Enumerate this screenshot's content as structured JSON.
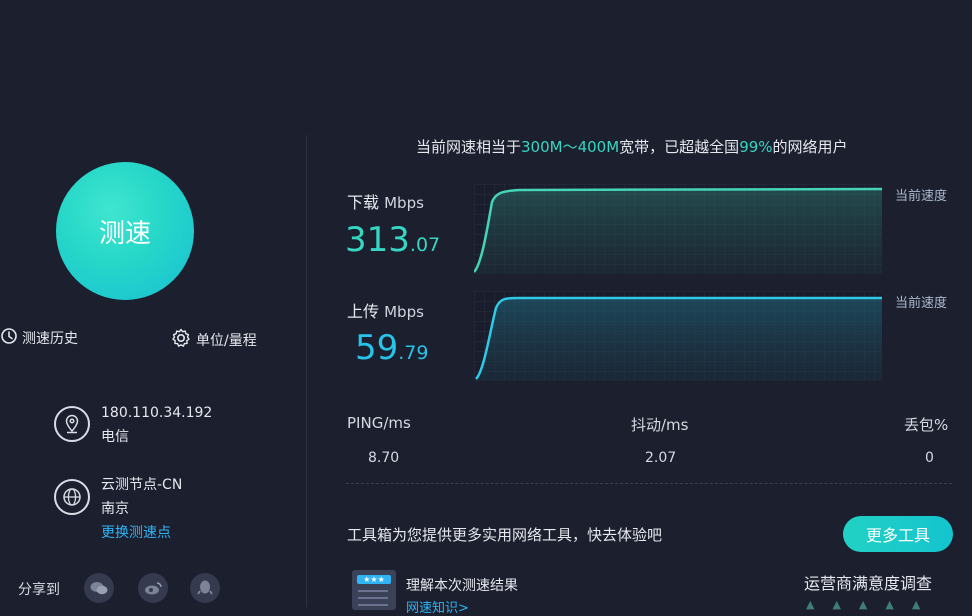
{
  "left": {
    "speed_button": "测速",
    "history_link": "测速历史",
    "unit_link": "单位/量程",
    "ip": {
      "address": "180.110.34.192",
      "isp": "电信"
    },
    "node": {
      "name": "云测节点-CN",
      "city": "南京",
      "change_link": "更换测速点"
    },
    "share_label": "分享到",
    "share_icons": [
      "wechat-icon",
      "weibo-icon",
      "qq-icon"
    ]
  },
  "headline": {
    "prefix": "当前网速相当于",
    "range": "300M～400M",
    "mid": "宽带，已超越全国",
    "percent": "99%",
    "suffix": "的网络用户"
  },
  "download": {
    "label": "下载",
    "unit": "Mbps",
    "int": "313",
    "dec": ".07",
    "marker": "当前速度",
    "color": "#35d6c2"
  },
  "upload": {
    "label": "上传",
    "unit": "Mbps",
    "int": "59",
    "dec": ".79",
    "marker": "当前速度",
    "color": "#27c3e8"
  },
  "stats": {
    "ping": {
      "label": "PING/ms",
      "value": "8.70"
    },
    "jitter": {
      "label": "抖动/ms",
      "value": "2.07"
    },
    "loss": {
      "label": "丢包%",
      "value": "0"
    }
  },
  "tools": {
    "promo": "工具箱为您提供更多实用网络工具，快去体验吧",
    "more_button": "更多工具",
    "card_title": "理解本次测速结果",
    "card_link": "网速知识>",
    "survey": "运营商满意度调查"
  }
}
